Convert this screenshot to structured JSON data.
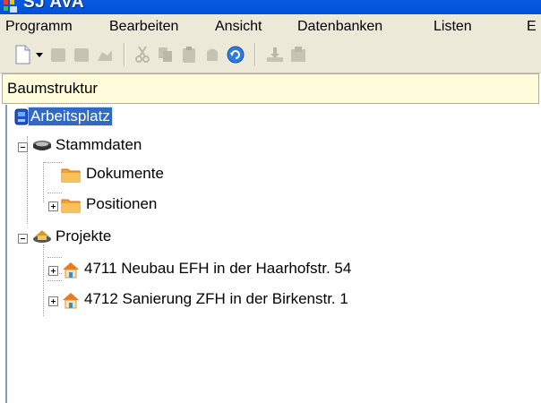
{
  "window": {
    "title": "SJ AVA"
  },
  "menu": [
    "Programm",
    "Bearbeiten",
    "Ansicht",
    "Datenbanken",
    "Listen",
    "E"
  ],
  "toolbar": {
    "buttons": [
      "new-document-icon",
      "dropdown-arrow-icon",
      "disabled-icon",
      "disabled-icon",
      "disabled-icon",
      "cut-icon",
      "copy-icon",
      "paste-icon",
      "disabled-icon",
      "refresh-icon",
      "disabled-icon",
      "disabled-icon"
    ]
  },
  "panel": {
    "title": "Baumstruktur"
  },
  "tree": {
    "root": "Arbeitsplatz",
    "stammdaten": "Stammdaten",
    "dokumente": "Dokumente",
    "positionen": "Positionen",
    "projekte": "Projekte",
    "projects": [
      "4711 Neubau EFH in der Haarhofstr. 54",
      "4712 Sanierung ZFH in der Birkenstr. 1"
    ]
  },
  "colors": {
    "titlebar": "#0451d8",
    "selection": "#316ac5",
    "header_bg": "#fffbdb",
    "menubar": "#ece9d8"
  }
}
